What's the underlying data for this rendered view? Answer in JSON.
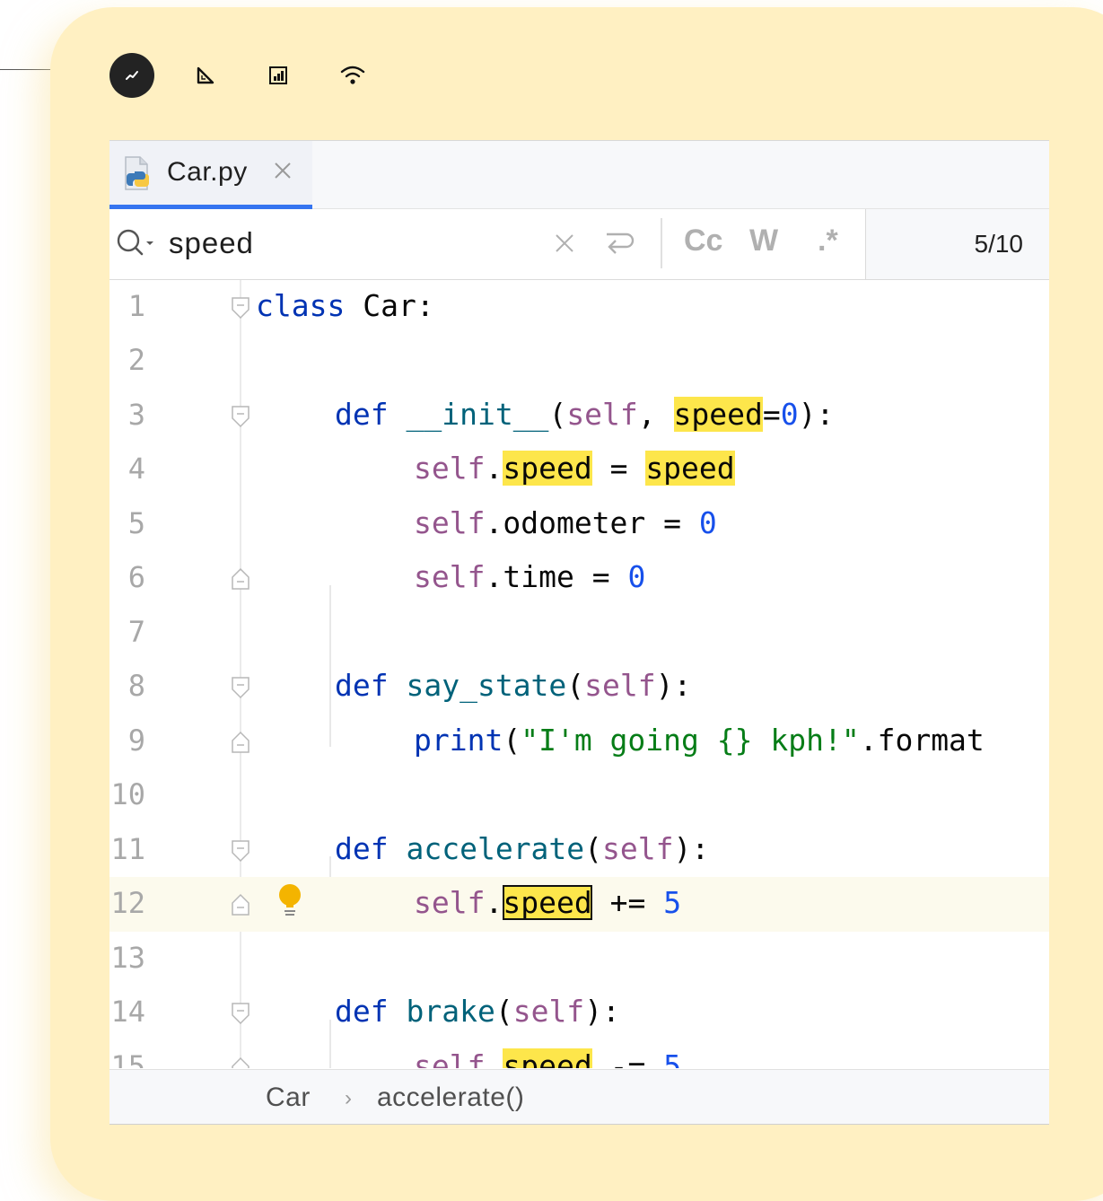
{
  "tab": {
    "filename": "Car.py"
  },
  "search": {
    "query": "speed",
    "options": {
      "match_case": "Cc",
      "words": "W",
      "regex": ".*"
    },
    "match_count": "5/10"
  },
  "code_lines": [
    {
      "n": "1"
    },
    {
      "n": "2"
    },
    {
      "n": "3"
    },
    {
      "n": "4"
    },
    {
      "n": "5"
    },
    {
      "n": "6"
    },
    {
      "n": "7"
    },
    {
      "n": "8"
    },
    {
      "n": "9"
    },
    {
      "n": "10"
    },
    {
      "n": "11"
    },
    {
      "n": "12"
    },
    {
      "n": "13"
    },
    {
      "n": "14"
    },
    {
      "n": "15"
    }
  ],
  "breadcrumb": {
    "class": "Car",
    "separator": "›",
    "method": "accelerate()"
  },
  "colors": {
    "keyword": "#0033b3",
    "function": "#00627a",
    "self": "#94558d",
    "number": "#1750eb",
    "string": "#067d17",
    "match_highlight": "#fde64b",
    "tab_accent": "#3574f0",
    "card_background": "#fff0c2"
  },
  "icons": [
    "chart-line-icon",
    "ruler-triangle-icon",
    "bar-chart-icon",
    "wifi-icon",
    "python-file-icon",
    "close-icon",
    "search-icon",
    "clear-icon",
    "newline-icon",
    "lightbulb-icon"
  ]
}
